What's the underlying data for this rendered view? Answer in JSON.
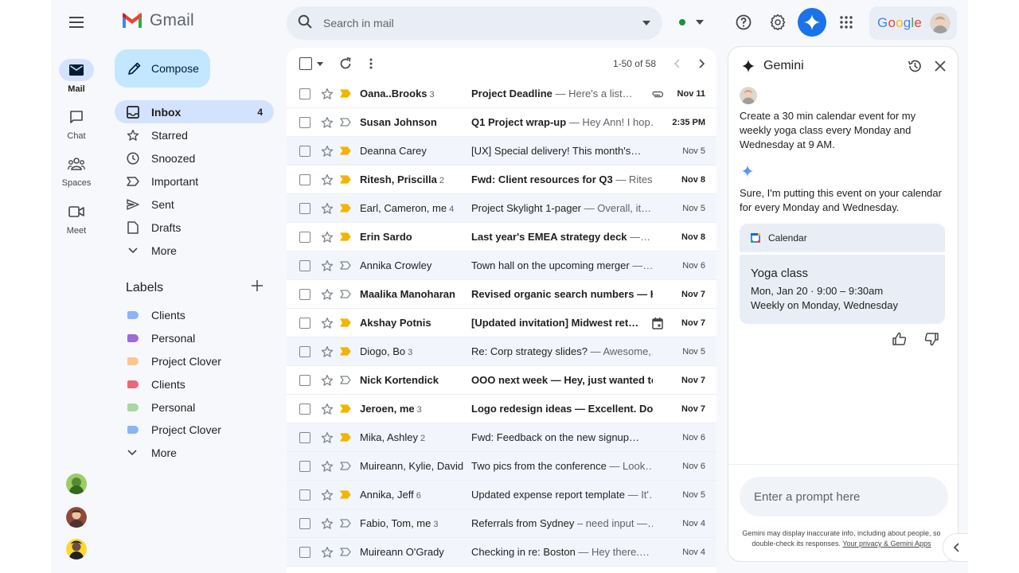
{
  "app": {
    "name": "Gmail"
  },
  "rail": {
    "items": [
      {
        "label": "Mail"
      },
      {
        "label": "Chat"
      },
      {
        "label": "Spaces"
      },
      {
        "label": "Meet"
      }
    ]
  },
  "compose": {
    "label": "Compose"
  },
  "nav": {
    "items": [
      {
        "label": "Inbox",
        "count": "4",
        "icon": "inbox-icon"
      },
      {
        "label": "Starred",
        "icon": "star-icon"
      },
      {
        "label": "Snoozed",
        "icon": "clock-icon"
      },
      {
        "label": "Important",
        "icon": "label-important-icon"
      },
      {
        "label": "Sent",
        "icon": "send-icon"
      },
      {
        "label": "Drafts",
        "icon": "draft-icon"
      },
      {
        "label": "More",
        "icon": "chevron-down-icon"
      }
    ]
  },
  "labels": {
    "heading": "Labels",
    "items": [
      {
        "label": "Clients",
        "color": "#8ab4f8"
      },
      {
        "label": "Personal",
        "color": "#9e69d8"
      },
      {
        "label": "Project Clover",
        "color": "#fcc58c"
      },
      {
        "label": "Clients",
        "color": "#e8697a"
      },
      {
        "label": "Personal",
        "color": "#a8d8a0"
      },
      {
        "label": "Project Clover",
        "color": "#8ab4f8"
      }
    ],
    "more": "More"
  },
  "search": {
    "placeholder": "Search in mail"
  },
  "account": {
    "brand": "Google"
  },
  "toolbar": {
    "range": "1-50 of 58"
  },
  "emails": [
    {
      "sender": "Oana..Brooks",
      "count": "3",
      "subject": "Project Deadline",
      "snippet": " — Here's a list…",
      "date": "Nov 11",
      "unread": true,
      "important": true,
      "attach": "paperclip"
    },
    {
      "sender": "Susan Johnson",
      "count": "",
      "subject": "Q1 Project wrap-up",
      "snippet": " — Hey Ann! I hop…",
      "date": "2:35 PM",
      "unread": true,
      "important": false,
      "attach": ""
    },
    {
      "sender": "Deanna Carey",
      "count": "",
      "subject": "[UX] Special delivery! This month's…",
      "snippet": "",
      "date": "Nov 5",
      "unread": false,
      "important": true,
      "attach": ""
    },
    {
      "sender": "Ritesh, Priscilla",
      "count": "2",
      "subject": "Fwd: Client resources for Q3",
      "snippet": " — Ritesh,…",
      "date": "Nov 8",
      "unread": true,
      "important": true,
      "attach": ""
    },
    {
      "sender": "Earl, Cameron, me",
      "count": "4",
      "subject": "Project Skylight 1-pager",
      "snippet": " — Overall, it…",
      "date": "Nov 5",
      "unread": false,
      "important": true,
      "attach": ""
    },
    {
      "sender": "Erin Sardo",
      "count": "",
      "subject": "Last year's EMEA strategy deck",
      "snippet": " —…",
      "date": "Nov 8",
      "unread": true,
      "important": true,
      "attach": ""
    },
    {
      "sender": "Annika Crowley",
      "count": "",
      "subject": "Town hall on the upcoming merger",
      "snippet": " —…",
      "date": "Nov 6",
      "unread": false,
      "important": false,
      "attach": ""
    },
    {
      "sender": "Maalika Manoharan",
      "count": "",
      "subject": "Revised organic search numbers",
      "snippet": " — Hi,…",
      "date": "Nov 7",
      "unread": true,
      "important": false,
      "attach": "",
      "boldsnip": true
    },
    {
      "sender": "Akshay Potnis",
      "count": "",
      "subject": "[Updated invitation] Midwest ret…",
      "snippet": "",
      "date": "Nov 7",
      "unread": true,
      "important": true,
      "attach": "calendar"
    },
    {
      "sender": "Diogo, Bo",
      "count": "3",
      "subject": "Re: Corp strategy slides?",
      "snippet": " — Awesome,…",
      "date": "Nov 5",
      "unread": false,
      "important": true,
      "attach": ""
    },
    {
      "sender": "Nick Kortendick",
      "count": "",
      "subject": "OOO next week",
      "snippet": " — Hey, just wanted to…",
      "date": "Nov 7",
      "unread": true,
      "important": false,
      "attach": "",
      "boldsnip": true
    },
    {
      "sender": "Jeroen, me",
      "count": "3",
      "subject": "Logo redesign ideas",
      "snippet": " — Excellent. Do h…",
      "date": "Nov 7",
      "unread": true,
      "important": true,
      "attach": "",
      "boldsnip": true
    },
    {
      "sender": "Mika, Ashley",
      "count": "2",
      "subject": "Fwd: Feedback on the new signup…",
      "snippet": "",
      "date": "Nov 6",
      "unread": false,
      "important": true,
      "attach": ""
    },
    {
      "sender": "Muireann, Kylie, David",
      "count": "",
      "subject": "Two pics from the conference",
      "snippet": " — Look…",
      "date": "Nov 6",
      "unread": false,
      "important": false,
      "attach": ""
    },
    {
      "sender": "Annika, Jeff",
      "count": "6",
      "subject": "Updated expense report template",
      "snippet": " — It'…",
      "date": "Nov 5",
      "unread": false,
      "important": true,
      "attach": ""
    },
    {
      "sender": "Fabio, Tom, me",
      "count": "3",
      "subject": "Referrals from Sydney",
      "snippet": " – need input —…",
      "date": "Nov 4",
      "unread": false,
      "important": false,
      "attach": ""
    },
    {
      "sender": "Muireann O'Grady",
      "count": "",
      "subject": "Checking in re: Boston",
      "snippet": " — Hey there.…",
      "date": "Nov 4",
      "unread": false,
      "important": false,
      "attach": ""
    }
  ],
  "gemini": {
    "title": "Gemini",
    "prompt": "Create a 30 min calendar event for my weekly yoga class every Monday and Wednesday at 9 AM.",
    "response": "Sure, I'm putting this event on your calendar for every Monday and Wednesday.",
    "calendar_label": "Calendar",
    "event": {
      "title": "Yoga class",
      "when": "Mon, Jan 20 · 9:00 – 9:30am",
      "repeat": "Weekly on Monday, Wednesday"
    },
    "input_placeholder": "Enter a prompt here",
    "disclaimer": "Gemini may display inaccurate info, including about people, so double-check its responses. ",
    "privacy_link": "Your privacy & Gemini Apps"
  },
  "colors": {
    "accent": "#0b57d0",
    "compose_bg": "#c2e7ff",
    "selected": "#d3e3fd",
    "important_marker": "#f4b400"
  }
}
